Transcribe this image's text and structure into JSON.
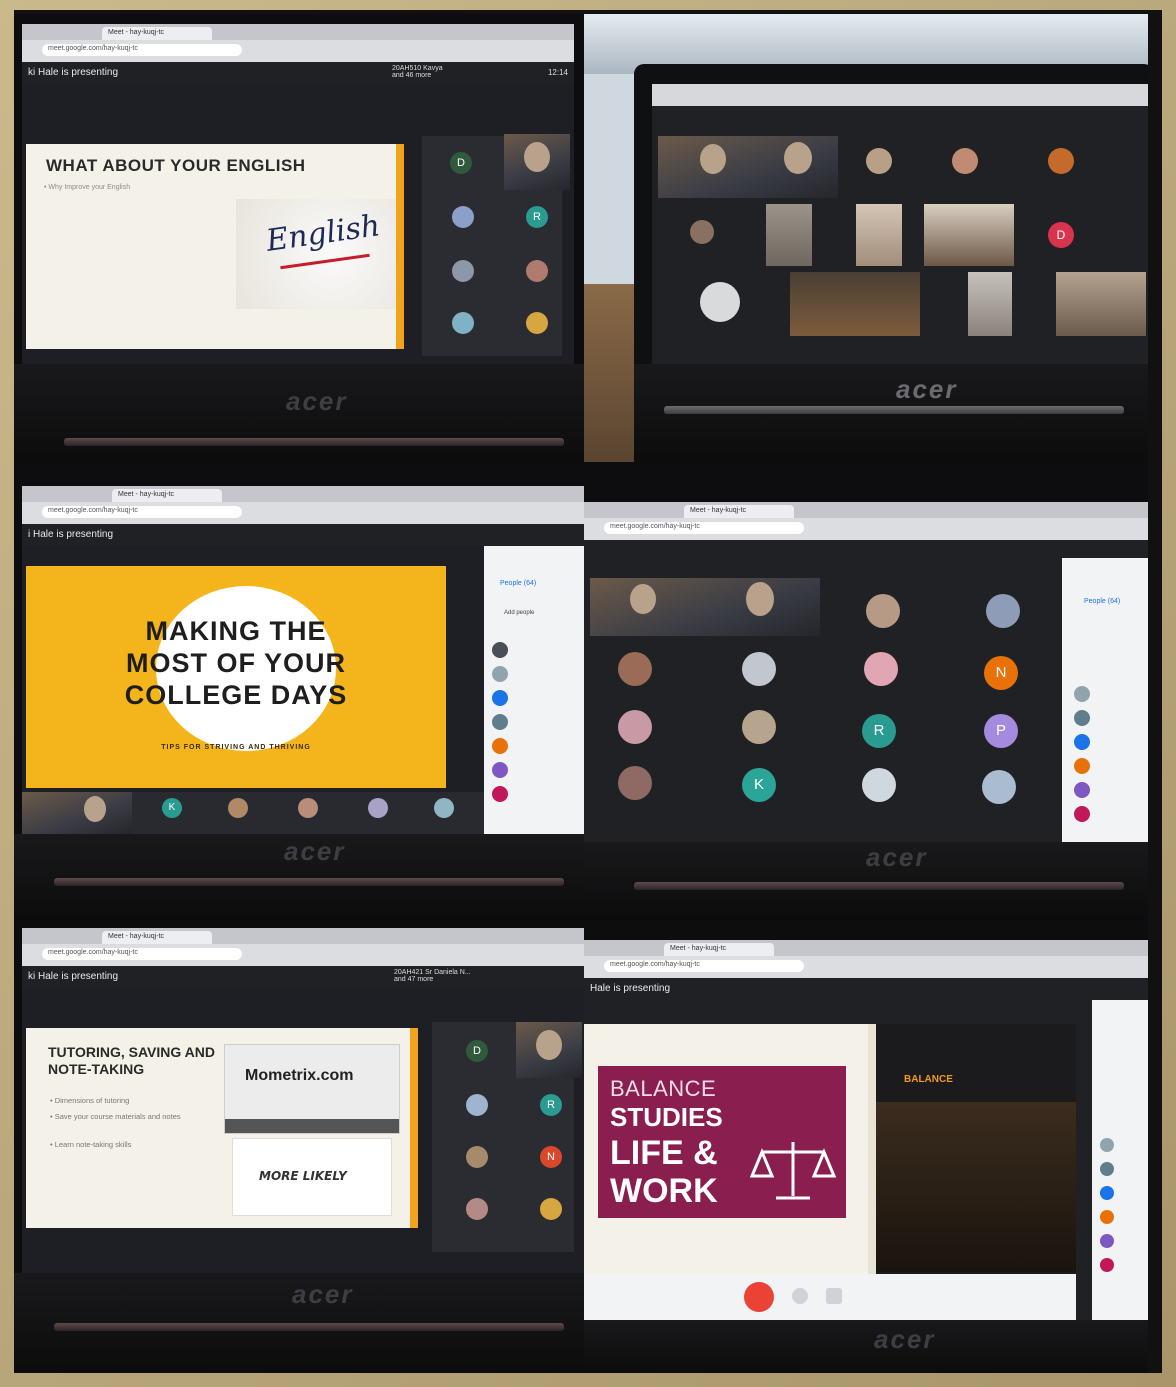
{
  "panels": {
    "p1": {
      "presenting": "ki Hale is presenting",
      "participants": "20AH510 Kavya\nand 46 more",
      "clock": "12:14",
      "slide_title": "WHAT ABOUT YOUR ENGLISH",
      "slide_bullet": "• Why Improve your English",
      "slide_word": "English",
      "tiles": [
        "D",
        "R"
      ],
      "brand": "acer"
    },
    "p2": {
      "brand": "acer",
      "tiles": [
        "D"
      ]
    },
    "p3": {
      "presenting": "i Hale is presenting",
      "slide_line1": "MAKING THE",
      "slide_line2": "MOST OF YOUR",
      "slide_line3": "COLLEGE DAYS",
      "slide_sub": "TIPS FOR STRIVING AND THRIVING",
      "people_label": "People (64)",
      "add_people": "Add people",
      "tiles": [
        "K"
      ],
      "brand": "acer"
    },
    "p4": {
      "people_label": "People (64)",
      "tiles": [
        "N",
        "R",
        "P",
        "K"
      ],
      "brand": "acer"
    },
    "p5": {
      "presenting": "ki Hale is presenting",
      "participants": "20AH421 Sr Daniela N...\nand 47 more",
      "slide_title": "TUTORING, SAVING AND NOTE-TAKING",
      "bullets": [
        "• Dimensions of tutoring",
        "• Save your course materials and notes",
        "• Learn note-taking skills"
      ],
      "mometrix": "Mometrix.com",
      "note_text": "MORE LIKELY",
      "tiles": [
        "D",
        "R",
        "N"
      ],
      "brand": "acer"
    },
    "p6": {
      "presenting": "Hale is presenting",
      "slide_line1": "BALANCE",
      "slide_line2": "STUDIES",
      "slide_line3": "LIFE &",
      "slide_line4": "WORK",
      "side_label": "BALANCE",
      "brand": "acer"
    }
  },
  "colors": {
    "yellow": "#f3b51b",
    "maroon": "#8a1e4f",
    "meet_dark": "#202124",
    "frame": "#c4b386"
  }
}
